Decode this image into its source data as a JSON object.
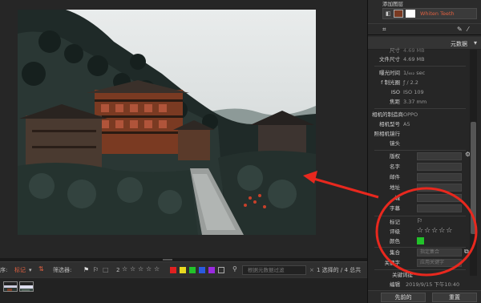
{
  "layers": {
    "title": "添加图层",
    "layer_name": "Whiten Teeth"
  },
  "metadata": {
    "header": "元数据",
    "file_size_label": "文件尺寸",
    "file_size": "4.69 MB",
    "partial_size": "4.69 MB",
    "exposure_label": "曝光时间",
    "exposure": "1/₆₅₂ sec",
    "aperture_label": "f 制光圈",
    "aperture": "ƒ / 2.2",
    "iso_label": "ISO",
    "iso": "ISO 109",
    "focal_label": "焦距",
    "focal": "3.37 mm",
    "make_label": "相机的制造商",
    "make": "OPPO",
    "model_label": "相机型号",
    "model": "A5",
    "shutter_label": "照相机镜行",
    "lens_label": "镜头",
    "copyright_label": "版权",
    "title_label": "名字",
    "caption_label": "邮件",
    "address_label": "地址",
    "city_label": "城",
    "subtitle_label": "字幕",
    "flag_label": "标记",
    "rating_label": "评级",
    "rating_stars": "☆☆☆☆☆",
    "color_label": "颜色",
    "color_value": "#22c22a",
    "collection_label": "集合",
    "collection_placeholder": "指定集合",
    "keyword_label": "关键字",
    "keyword_placeholder": "应用关键字",
    "related_label": "关键词提",
    "date_label": "编辑",
    "date_value": "2019/9/15 下午10:40"
  },
  "filterbar": {
    "sort_label": "序:",
    "sort_value": "标记",
    "filter_label": "筛选器:",
    "search_placeholder": "根据元数据过滤",
    "count_text": "1 选择的 / 4 总共",
    "star_count": "2"
  },
  "buttons": {
    "prev": "先前的",
    "reset": "重置"
  },
  "colors": {
    "red": "#e02020",
    "yellow": "#e8d820",
    "green": "#22c22a",
    "blue": "#2a5ae0",
    "purple": "#9a2ae0",
    "annotation": "#e8281e"
  }
}
